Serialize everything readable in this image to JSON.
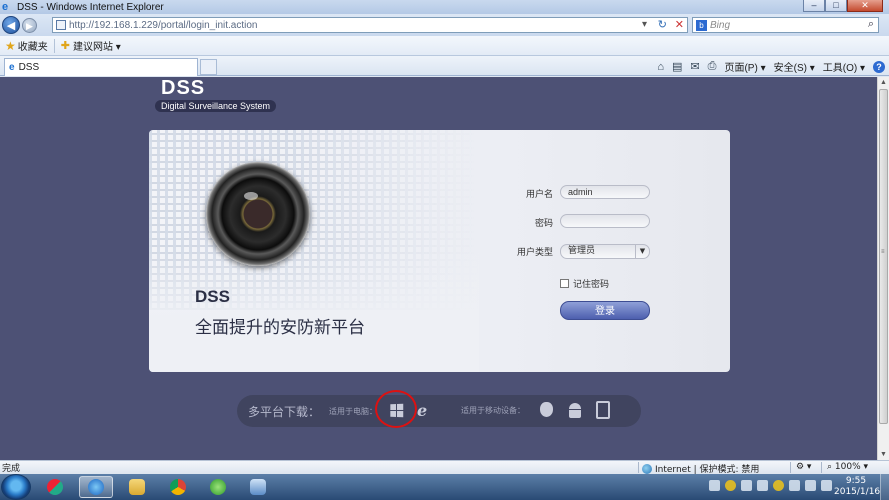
{
  "window": {
    "title": "DSS - Windows Internet Explorer",
    "minimize": "–",
    "maximize": "□",
    "close": "✕"
  },
  "addressbar": {
    "url": "http://192.168.1.229/portal/login_init.action",
    "search_placeholder": "Bing"
  },
  "favorites": {
    "label": "收藏夹",
    "suggested_sites": "建议网站 ▾"
  },
  "tab": {
    "title": "DSS"
  },
  "commands": {
    "page": "页面(P) ▾",
    "safety": "安全(S) ▾",
    "tools": "工具(O) ▾"
  },
  "page": {
    "logo": "DSS",
    "logo_subtitle": "Digital Surveillance System",
    "brand_title": "DSS",
    "brand_slogan": "全面提升的安防新平台",
    "form": {
      "username_label": "用户名",
      "username_value": "admin",
      "password_label": "密码",
      "password_value": "",
      "user_type_label": "用户类型",
      "user_type_value": "管理员",
      "remember_label": "记住密码",
      "remember_checked": false,
      "login_button": "登录"
    },
    "download": {
      "title": "多平台下载：",
      "pc_label": "适用于电脑：",
      "mobile_label": "适用于移动设备："
    }
  },
  "statusbar": {
    "status": "完成",
    "zone": "Internet | 保护模式: 禁用",
    "zoom": "100%"
  },
  "taskbar": {
    "time": "9:55",
    "date": "2015/1/16"
  }
}
